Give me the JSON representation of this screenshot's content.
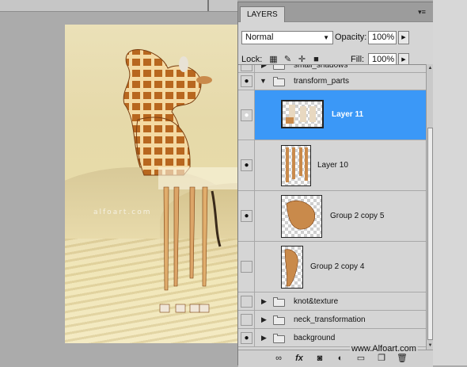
{
  "canvas": {
    "watermark": "alfoart.com"
  },
  "panel": {
    "tab_label": "LAYERS",
    "blend_mode": "Normal",
    "opacity_label": "Opacity:",
    "opacity_value": "100%",
    "lock_label": "Lock:",
    "fill_label": "Fill:",
    "fill_value": "100%"
  },
  "layers": [
    {
      "name": "small_shadows",
      "type": "group",
      "visible": false,
      "expanded": false
    },
    {
      "name": "transform_parts",
      "type": "group",
      "visible": true,
      "expanded": true
    },
    {
      "name": "Layer 11",
      "type": "layer",
      "visible": true,
      "selected": true
    },
    {
      "name": "Layer 10",
      "type": "layer",
      "visible": true
    },
    {
      "name": "Group 2 copy 5",
      "type": "layer",
      "visible": true
    },
    {
      "name": "Group 2 copy 4",
      "type": "layer",
      "visible": false
    },
    {
      "name": "knot&texture",
      "type": "group",
      "visible": false,
      "expanded": false
    },
    {
      "name": "neck_transformation",
      "type": "group",
      "visible": false,
      "expanded": false
    },
    {
      "name": "background",
      "type": "group",
      "visible": true,
      "expanded": false
    }
  ],
  "credit": "www.Alfoart.com",
  "colors": {
    "selection": "#3b98f7",
    "panel_bg": "#d5d5d5",
    "workspace": "#ababab"
  },
  "icons": {
    "visibility": "eye-icon",
    "group": "folder-icon",
    "lock_transparent": "lock-transparent-pixels-icon",
    "lock_image": "lock-image-pixels-icon",
    "lock_position": "lock-position-icon",
    "lock_all": "lock-all-icon",
    "bottom": [
      "link-layers-icon",
      "layer-style-fx-icon",
      "layer-mask-icon",
      "adjustment-layer-icon",
      "new-group-icon",
      "new-layer-icon",
      "delete-layer-icon"
    ]
  }
}
